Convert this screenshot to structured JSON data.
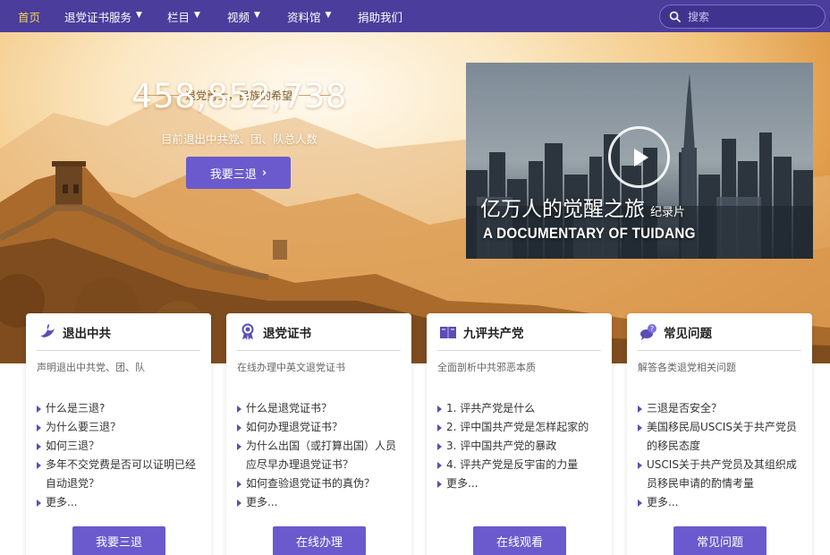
{
  "nav": {
    "items": [
      {
        "label": "首页",
        "has_dropdown": false
      },
      {
        "label": "退党证书服务",
        "has_dropdown": true
      },
      {
        "label": "栏目",
        "has_dropdown": true
      },
      {
        "label": "视频",
        "has_dropdown": true
      },
      {
        "label": "资料馆",
        "has_dropdown": true
      },
      {
        "label": "捐助我们",
        "has_dropdown": false
      }
    ],
    "search_placeholder": "搜索",
    "search_icon": "search-icon",
    "chevron_icon": "chevron-down-icon"
  },
  "hero": {
    "tagline": "退党勇士，民族的希望",
    "counter": "458,852,738",
    "counter_desc": "目前退出中共党、团、队总人数",
    "cta_label": "我要三退",
    "cta_icon": "chevron-right-icon"
  },
  "video": {
    "title": "亿万人的觉醒之旅",
    "title_tag": "纪录片",
    "subtitle": "A DOCUMENTARY OF TUIDANG",
    "play_icon": "play-icon"
  },
  "cards": [
    {
      "icon": "dove-icon",
      "title": "退出中共",
      "desc": "声明退出中共党、团、队",
      "items": [
        "什么是三退?",
        "为什么要三退？",
        "如何三退？",
        "多年不交党费是否可以证明已经自动退党？",
        "更多..."
      ],
      "button": "我要三退"
    },
    {
      "icon": "certificate-icon",
      "title": "退党证书",
      "desc": "在线办理中英文退党证书",
      "items": [
        "什么是退党证书？",
        "如何办理退党证书？",
        "为什么出国（或打算出国）人员应尽早办理退党证书？",
        "如何查验退党证书的真伪？",
        "更多..."
      ],
      "button": "在线办理"
    },
    {
      "icon": "book-icon",
      "title": "九评共产党",
      "desc": "全面剖析中共邪恶本质",
      "items": [
        "1. 评共产党是什么",
        "2. 评中国共产党是怎样起家的",
        "3. 评中国共产党的暴政",
        "4. 评共产党是反宇宙的力量",
        "更多..."
      ],
      "button": "在线观看"
    },
    {
      "icon": "chat-question-icon",
      "title": "常见问题",
      "desc": "解答各类退党相关问题",
      "items": [
        "三退是否安全？",
        "美国移民局USCIS关于共产党员的移民态度",
        "USCIS关于共产党员及其组织成员移民申请的酌情考量",
        "更多..."
      ],
      "button": "常见问题"
    }
  ],
  "colors": {
    "nav_bg": "#4a3d9c",
    "accent": "#6a5acd",
    "nav_home": "#f3d257"
  }
}
